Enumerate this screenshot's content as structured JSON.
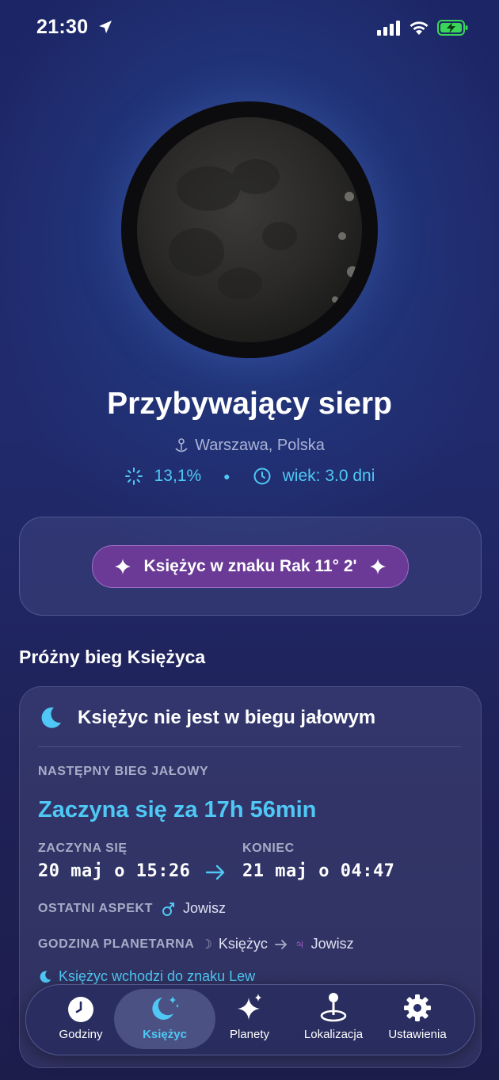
{
  "status": {
    "time": "21:30"
  },
  "moon": {
    "phase_name": "Przybywający sierp",
    "location": "Warszawa, Polska",
    "illumination": "13,1%",
    "age": "wiek: 3.0 dni",
    "illumination_fraction": 0.131
  },
  "sign": {
    "label": "Księżyc w znaku Rak 11° 2'"
  },
  "void_section": {
    "title": "Próżny bieg Księżyca",
    "status": "Księżyc nie jest w biegu jałowym",
    "next_label": "NASTĘPNY BIEG JAŁOWY",
    "countdown": "Zaczyna się za 17h 56min",
    "start_label": "ZACZYNA SIĘ",
    "start_value": "20 maj o 15:26",
    "end_label": "KONIEC",
    "end_value": "21 maj o 04:47",
    "last_aspect_label": "OSTATNI ASPEKT",
    "last_aspect_value": "Jowisz",
    "planetary_hour_label": "GODZINA PLANETARNA",
    "planetary_hour_from": "Księżyc",
    "planetary_hour_to": "Jowisz",
    "enters_sign": "Księżyc wchodzi do znaku Lew"
  },
  "tabs": [
    {
      "label": "Godziny",
      "icon": "clock-icon"
    },
    {
      "label": "Księżyc",
      "icon": "moon-stars-icon",
      "active": true
    },
    {
      "label": "Planety",
      "icon": "sparkles-icon"
    },
    {
      "label": "Lokalizacja",
      "icon": "map-pin-icon"
    },
    {
      "label": "Ustawienia",
      "icon": "gear-icon"
    }
  ],
  "colors": {
    "accent": "#4fc8f5",
    "pill": "#6a3a96",
    "jupiter": "#b86be0"
  }
}
